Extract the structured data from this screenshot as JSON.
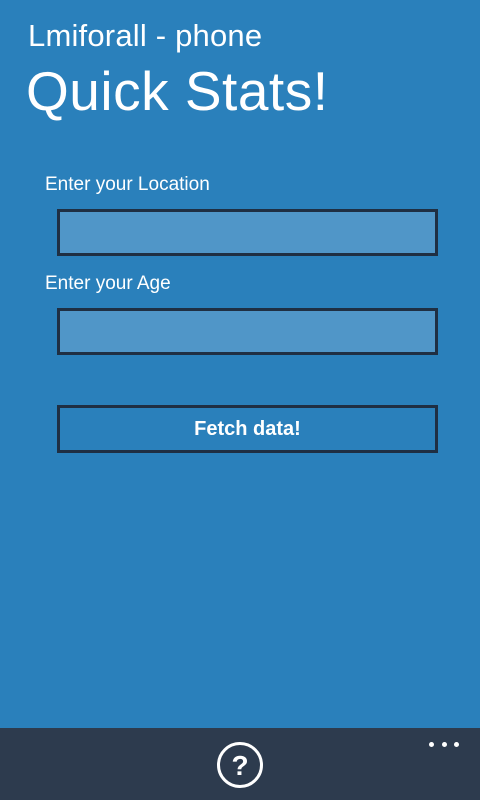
{
  "header": {
    "app_title": "Lmiforall - phone",
    "page_title": "Quick Stats!"
  },
  "form": {
    "location_label": "Enter your Location",
    "location_value": "",
    "age_label": "Enter your Age",
    "age_value": "",
    "fetch_label": "Fetch data!"
  },
  "app_bar": {
    "help_icon": "question-circle-icon",
    "help_glyph": "?",
    "more_icon": "ellipsis-icon"
  },
  "colors": {
    "page_background": "#2a80bb",
    "input_background": "#5096c8",
    "border": "#1f2f43",
    "app_bar_background": "#2d3b4e",
    "text": "#ffffff"
  }
}
